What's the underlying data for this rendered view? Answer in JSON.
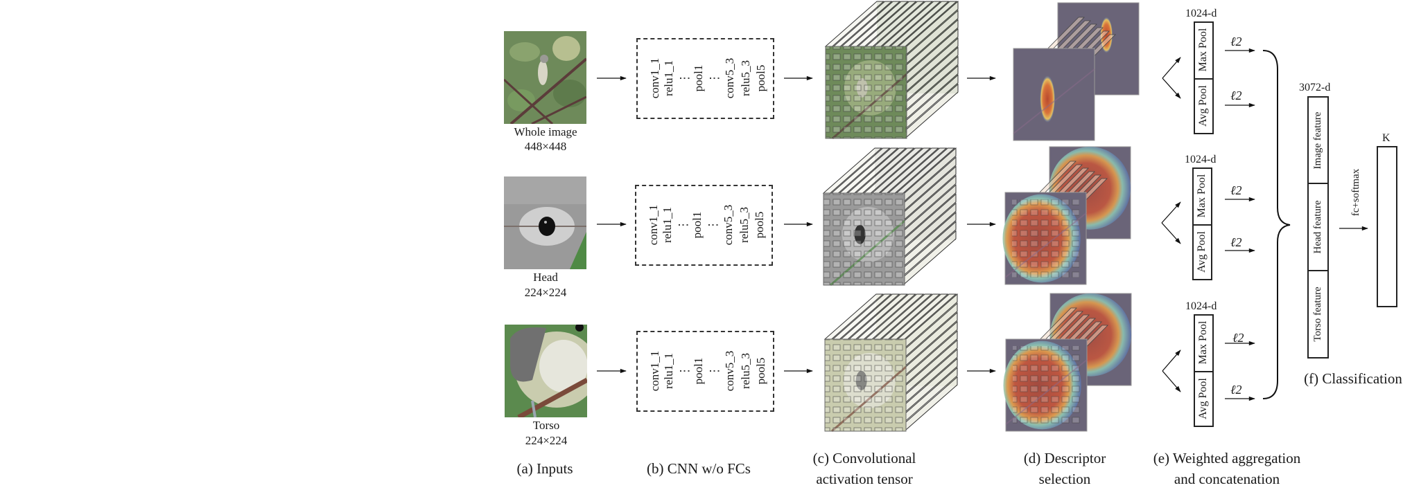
{
  "figure": {
    "rows": [
      {
        "id": "whole",
        "input_name": "Whole image",
        "input_size": "448×448",
        "photo_colors": {
          "base": "#6e8a5a",
          "accent": "#a9b98a",
          "subject": "#c9c7b8",
          "branch": "#5b3c3a"
        },
        "heat": "small",
        "pool_dim": "1024-d",
        "pool_labels": [
          "Max Pool",
          "Avg Pool"
        ],
        "norm_label": "ℓ2"
      },
      {
        "id": "head",
        "input_name": "Head",
        "input_size": "224×224",
        "photo_colors": {
          "base": "#9a9a9a",
          "accent": "#c4c4c4",
          "subject": "#111111",
          "branch": "#4f8a45"
        },
        "heat": "large",
        "pool_dim": "1024-d",
        "pool_labels": [
          "Max Pool",
          "Avg Pool"
        ],
        "norm_label": "ℓ2"
      },
      {
        "id": "torso",
        "input_name": "Torso",
        "input_size": "224×224",
        "photo_colors": {
          "base": "#c9ccae",
          "accent": "#e6e6dc",
          "subject": "#707070",
          "branch": "#7a4a3a"
        },
        "heat": "large",
        "pool_dim": "1024-d",
        "pool_labels": [
          "Max Pool",
          "Avg Pool"
        ],
        "norm_label": "ℓ2"
      }
    ],
    "cnn_layers": [
      "conv1_1",
      "relu1_1",
      "⋮",
      "pool1",
      "⋮",
      "conv5_3",
      "relu5_3",
      "pool5"
    ],
    "concat": {
      "dim": "3072-d",
      "segments": [
        "Image feature",
        "Head feature",
        "Torso feature"
      ]
    },
    "classifier": {
      "op_label": "fc+softmax",
      "output_label": "K"
    },
    "captions": {
      "a": "(a) Inputs",
      "b": "(b) CNN w/o FCs",
      "c1": "(c) Convolutional",
      "c2": "activation tensor",
      "d1": "(d) Descriptor",
      "d2": "selection",
      "e1": "(e) Weighted aggregation",
      "e2": "and concatenation",
      "f": "(f) Classification"
    },
    "colors": {
      "ink": "#1a1a1a",
      "heat_hot": "#c8553a",
      "heat_warm": "#e8a04a",
      "heat_cool": "#5c8fd0",
      "desc_bg": "#6a6478"
    }
  }
}
